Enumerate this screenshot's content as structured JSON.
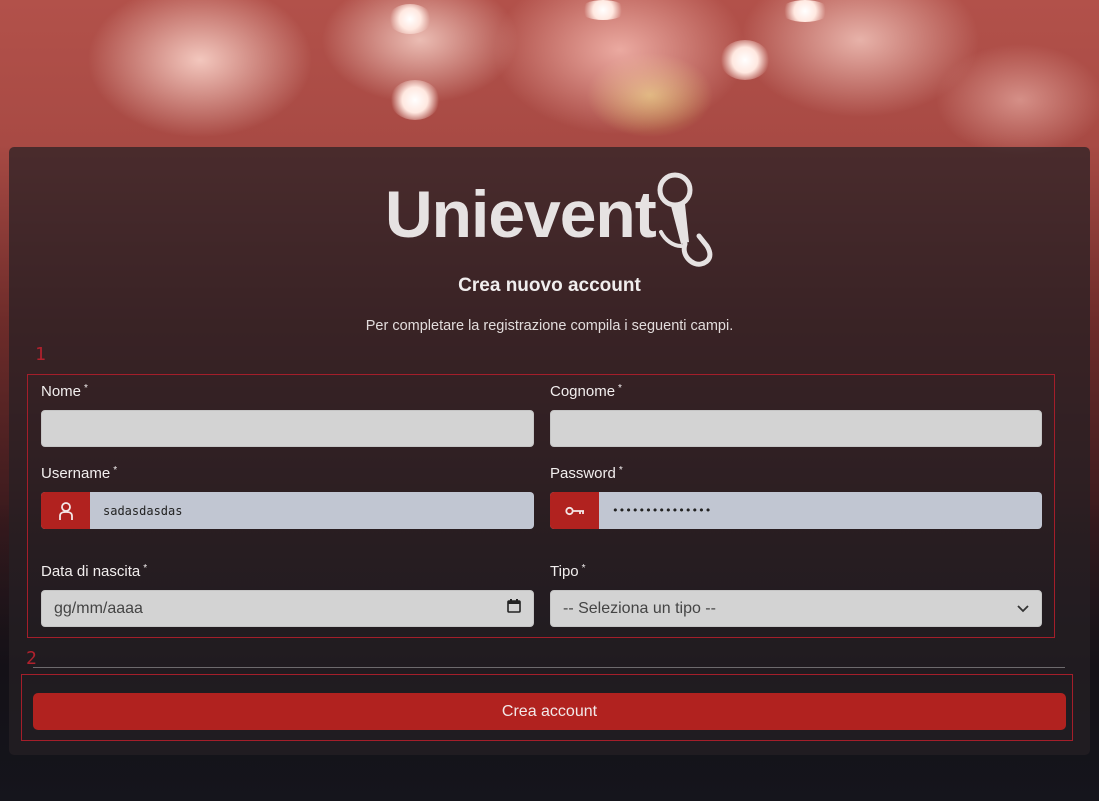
{
  "brand": {
    "logo_text": "Unievent"
  },
  "header": {
    "title": "Crea nuovo account",
    "subtitle": "Per completare la registrazione compila i seguenti campi."
  },
  "annotations": {
    "box1": "1",
    "box2": "2"
  },
  "form": {
    "required_mark": "*",
    "nome": {
      "label": "Nome",
      "value": ""
    },
    "cognome": {
      "label": "Cognome",
      "value": ""
    },
    "username": {
      "label": "Username",
      "value": "sadasdasdas",
      "icon": "user-icon"
    },
    "password": {
      "label": "Password",
      "value": "•••••••••••••••",
      "icon": "key-icon"
    },
    "birthdate": {
      "label": "Data di nascita",
      "placeholder": "gg/mm/aaaa",
      "icon": "calendar-icon"
    },
    "tipo": {
      "label": "Tipo",
      "selected": "-- Seleziona un tipo --",
      "icon": "chevron-down-icon"
    },
    "submit_label": "Crea account"
  },
  "colors": {
    "accent": "#b1221f",
    "annotation": "#a41e2a",
    "card": "#262024",
    "field": "#d3d3d3",
    "field_autofill": "#c1c6d2"
  }
}
